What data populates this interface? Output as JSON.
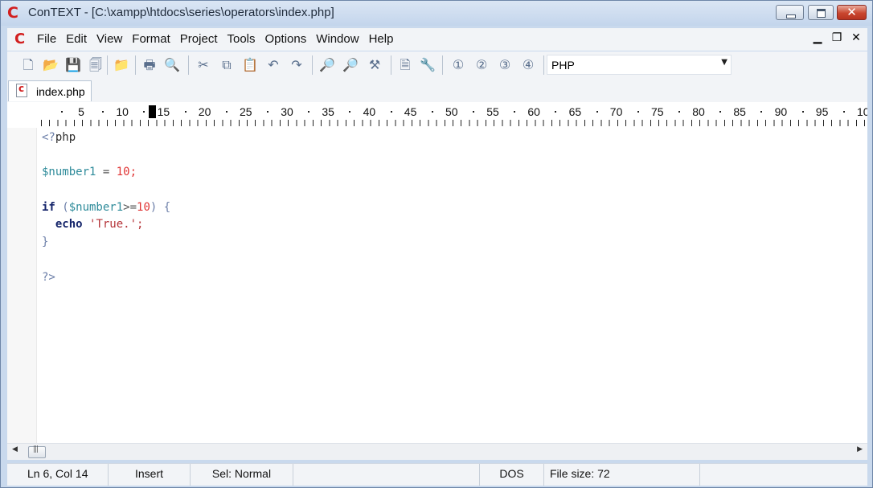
{
  "window": {
    "title": "ConTEXT - [C:\\xampp\\htdocs\\series\\operators\\index.php]",
    "app_icon": "context-logo-icon",
    "close_glyph": "✕"
  },
  "menu": {
    "items": [
      "File",
      "Edit",
      "View",
      "Format",
      "Project",
      "Tools",
      "Options",
      "Window",
      "Help"
    ],
    "mdi_minimize": "▁",
    "mdi_restore": "❐",
    "mdi_close": "✕"
  },
  "toolbar": {
    "icons": [
      {
        "name": "new-file-icon",
        "glyph": "🗋"
      },
      {
        "name": "open-folder-icon",
        "glyph": "📂"
      },
      {
        "name": "save-icon",
        "glyph": "💾"
      },
      {
        "name": "save-all-icon",
        "glyph": "🗐"
      },
      {
        "name": "open-project-icon",
        "glyph": "📁"
      },
      {
        "name": "print-icon",
        "glyph": "🖶"
      },
      {
        "name": "print-preview-icon",
        "glyph": "🔍"
      },
      {
        "name": "cut-icon",
        "glyph": "✂"
      },
      {
        "name": "copy-icon",
        "glyph": "⧉"
      },
      {
        "name": "paste-icon",
        "glyph": "📋"
      },
      {
        "name": "undo-icon",
        "glyph": "↶"
      },
      {
        "name": "redo-icon",
        "glyph": "↷"
      },
      {
        "name": "find-icon",
        "glyph": "🔎"
      },
      {
        "name": "find-next-icon",
        "glyph": "🔎"
      },
      {
        "name": "replace-icon",
        "glyph": "⚒"
      },
      {
        "name": "file-properties-icon",
        "glyph": "🗎"
      },
      {
        "name": "tools-icon",
        "glyph": "🔧"
      },
      {
        "name": "user-command-1-icon",
        "glyph": "①"
      },
      {
        "name": "user-command-2-icon",
        "glyph": "②"
      },
      {
        "name": "user-command-3-icon",
        "glyph": "③"
      },
      {
        "name": "user-command-4-icon",
        "glyph": "④"
      }
    ],
    "highlighter": "PHP",
    "dropdown_arrow": "▼"
  },
  "tabs": [
    {
      "label": "index.php"
    }
  ],
  "ruler": {
    "labels": [
      "5",
      "10",
      "15",
      "20",
      "25",
      "30",
      "35",
      "40",
      "45",
      "50",
      "55",
      "60",
      "65",
      "70",
      "75",
      "80",
      "85",
      "90",
      "95",
      "10"
    ]
  },
  "editor": {
    "lines": [
      [
        {
          "t": "<?",
          "c": "tok-tag"
        },
        {
          "t": "php",
          "c": "tok-tag-kw"
        }
      ],
      [],
      [
        {
          "t": "$number1",
          "c": "tok-var"
        },
        {
          "t": " = ",
          "c": "tok-op"
        },
        {
          "t": "10",
          "c": "tok-num"
        },
        {
          "t": ";",
          "c": "tok-num"
        }
      ],
      [],
      [
        {
          "t": "if",
          "c": "tok-kw"
        },
        {
          "t": " (",
          "c": "tok-punc"
        },
        {
          "t": "$number1",
          "c": "tok-var"
        },
        {
          "t": ">=",
          "c": "tok-op"
        },
        {
          "t": "10",
          "c": "tok-num"
        },
        {
          "t": ") {",
          "c": "tok-punc"
        }
      ],
      [
        {
          "t": "  ",
          "c": "tok-op"
        },
        {
          "t": "echo",
          "c": "tok-kw"
        },
        {
          "t": " ",
          "c": "tok-op"
        },
        {
          "t": "'True.'",
          "c": "tok-str"
        },
        {
          "t": ";",
          "c": "tok-str"
        }
      ],
      [
        {
          "t": "}",
          "c": "tok-punc"
        }
      ],
      [],
      [
        {
          "t": "?>",
          "c": "tok-tag"
        }
      ]
    ]
  },
  "scrollbar": {
    "left_arrow": "◀",
    "right_arrow": "▶"
  },
  "status": {
    "position": "Ln 6, Col 14",
    "mode": "Insert",
    "selection": "Sel: Normal",
    "empty": "",
    "line_endings": "DOS",
    "file_size": "File size: 72"
  }
}
